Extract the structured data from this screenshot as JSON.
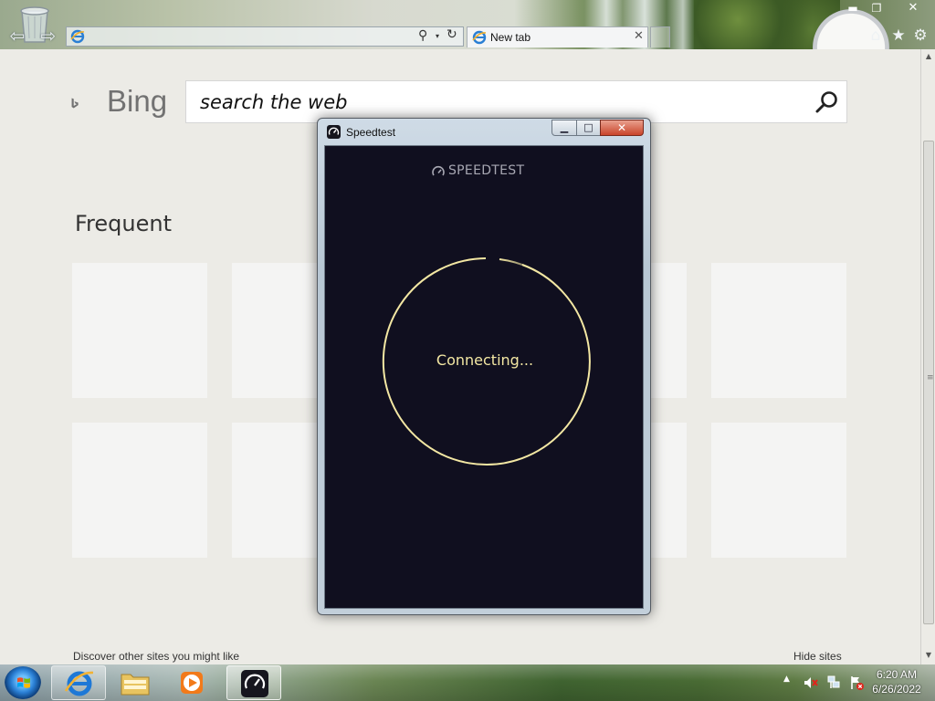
{
  "browser": {
    "address_value": "",
    "tab_title": "New tab",
    "tab_close": "✕",
    "back_glyph": "⇦",
    "forward_glyph": "⇨",
    "refresh_glyph": "↻",
    "dropdown_glyph": "▾"
  },
  "window_controls": {
    "minimize": "▬",
    "maximize": "❐",
    "close": "✕"
  },
  "toolbar_icons": {
    "home": "⌂",
    "favorites": "★",
    "tools": "⚙"
  },
  "bing": {
    "logo_text": "Bing",
    "search_placeholder": "search the web",
    "frequent_heading": "Frequent",
    "discover_link": "Discover other sites you might like",
    "hide_sites_link": "Hide sites"
  },
  "speedtest": {
    "window_title": "Speedtest",
    "brand": "SPEEDTEST",
    "status": "Connecting...",
    "controls": {
      "minimize": "▁",
      "maximize": "□",
      "close": "✕"
    }
  },
  "taskbar": {
    "apps": [
      "start-orb",
      "internet-explorer",
      "windows-explorer",
      "media-player",
      "speedtest"
    ],
    "tray_arrow": "▲",
    "time": "6:20 AM",
    "date": "6/26/2022"
  },
  "scrollbar": {
    "up": "▲",
    "down": "▼",
    "grip": "≡"
  },
  "colors": {
    "page_bg": "#ecebe6",
    "speedtest_bg": "#100f1f",
    "ring": "#f3e7a3",
    "status_text": "#f3e7a3"
  }
}
